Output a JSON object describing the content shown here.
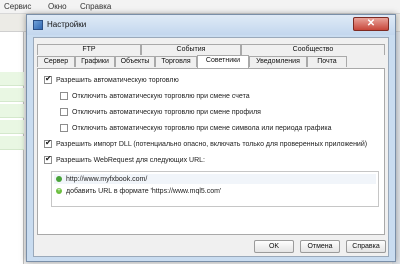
{
  "app": {
    "menu": [
      "Сервис",
      "Окно",
      "Справка"
    ]
  },
  "dialog": {
    "title": "Настройки",
    "close_glyph": "✕",
    "tabs_row1": [
      "FTP",
      "События",
      "Сообщество"
    ],
    "tabs_row2": [
      "Сервер",
      "Графики",
      "Объекты",
      "Торговля",
      "Советники",
      "Уведомления",
      "Почта"
    ],
    "active_tab": "Советники",
    "options": {
      "auto_trading": {
        "label": "Разрешить автоматическую торговлю",
        "checked": true
      },
      "disable_on_account_change": {
        "label": "Отключить автоматическую торговлю при смене счета",
        "checked": false
      },
      "disable_on_profile_change": {
        "label": "Отключить автоматическую торговлю при смене профиля",
        "checked": false
      },
      "disable_on_symbol_change": {
        "label": "Отключить автоматическую торговлю при смене символа или периода графика",
        "checked": false
      },
      "allow_dll": {
        "label": "Разрешить импорт DLL (потенциально опасно, включать только для проверенных приложений)",
        "checked": true
      },
      "allow_webrequest": {
        "label": "Разрешить WebRequest для следующих URL:",
        "checked": true
      }
    },
    "urls": [
      {
        "text": "http://www.myfxbook.com/",
        "icon": "green-dot-icon"
      },
      {
        "text": "добавить URL в формате 'https://www.mql5.com'",
        "icon": "plus-icon"
      }
    ],
    "buttons": {
      "ok": "OK",
      "cancel": "Отмена",
      "help": "Справка"
    }
  }
}
